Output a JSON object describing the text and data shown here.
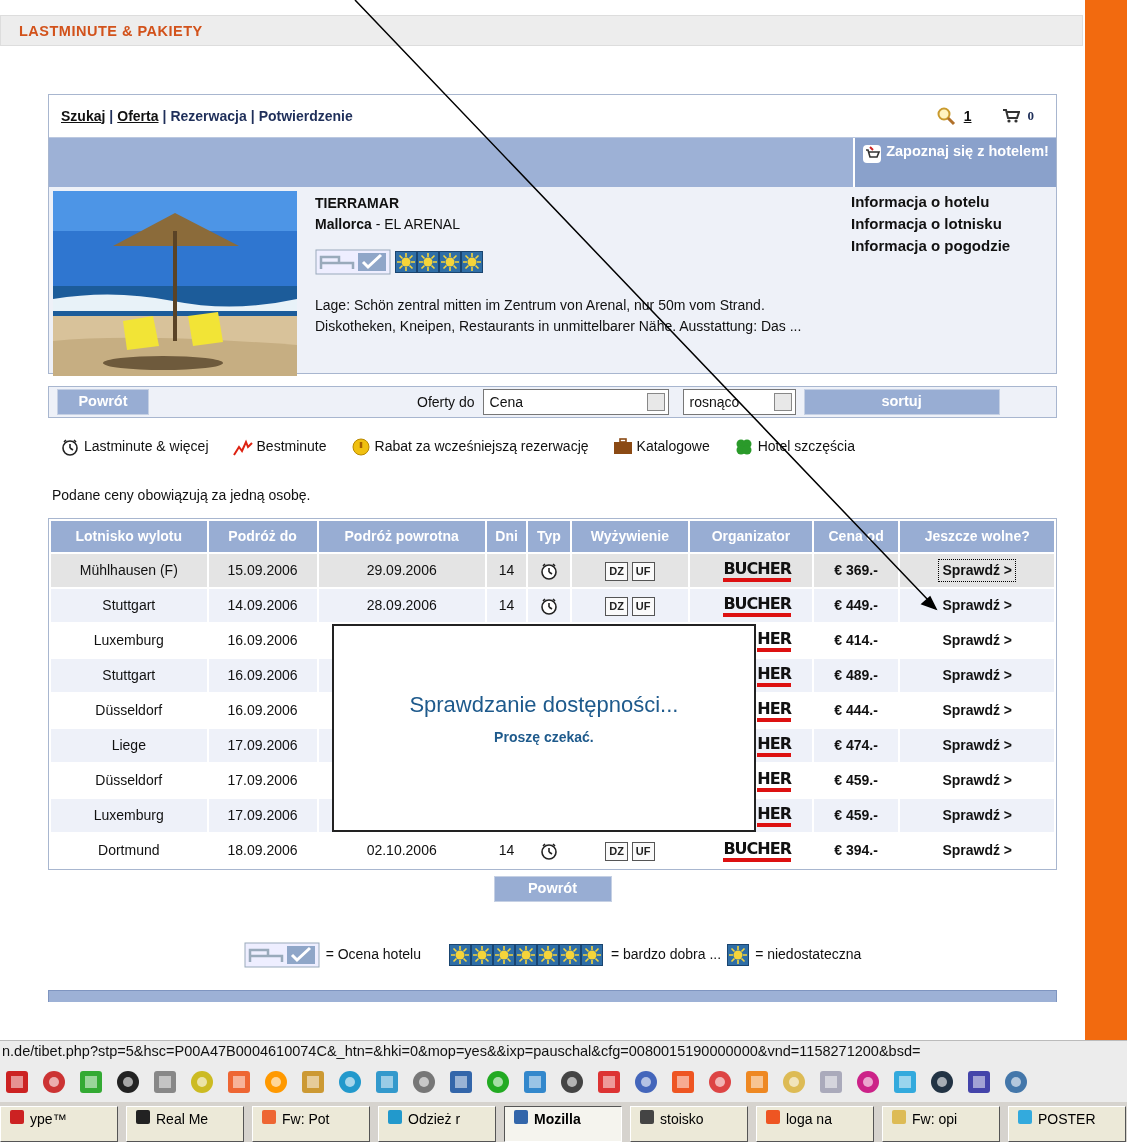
{
  "header": {
    "title": "LASTMINUTE & PAKIETY"
  },
  "nav": {
    "separator": "|",
    "steps": [
      {
        "label": "Szukaj",
        "link": true
      },
      {
        "label": "Oferta",
        "link": true
      },
      {
        "label": "Rezerwacja",
        "link": false
      },
      {
        "label": "Potwierdzenie",
        "link": false
      }
    ],
    "search_count": "1",
    "cart_count": "0"
  },
  "hotel": {
    "action": "Zapoznaj się z hotelem!",
    "name": "TIERRAMAR",
    "region": "Mallorca",
    "place": "- EL ARENAL",
    "stars": 4,
    "description": "Lage: Schön zentral mitten im Zentrum von Arenal, nur 50m vom Strand. Diskotheken, Kneipen, Restaurants in unmittelbarer Nähe. Ausstattung: Das ...",
    "links": [
      "Informacja o hotelu",
      "Informacja o lotnisku",
      "Informacja o pogodzie"
    ]
  },
  "sort_bar": {
    "back": "Powrót",
    "label": "Oferty do",
    "sort_field": "Cena",
    "order": "rosnąco",
    "sort_button": "sortuj"
  },
  "legend": [
    {
      "kind": "lastminute",
      "label": "Lastminute & więcej"
    },
    {
      "kind": "bestminute",
      "label": "Bestminute"
    },
    {
      "kind": "earlybird",
      "label": "Rabat za wcześniejszą rezerwację"
    },
    {
      "kind": "catalog",
      "label": "Katalogowe"
    },
    {
      "kind": "lucky",
      "label": "Hotel szczęścia"
    }
  ],
  "note": "Podane ceny obowiązują za jedną osobę.",
  "table": {
    "columns": [
      "Lotnisko wylotu",
      "Podróż do",
      "Podróż powrotna",
      "Dni",
      "Typ",
      "Wyżywienie",
      "Organizator",
      "Cena od",
      "Jeszcze wolne?"
    ],
    "rows": [
      {
        "airport": "Mühlhausen (F)",
        "depart": "15.09.2006",
        "return": "29.09.2006",
        "days": "14",
        "kind": "lastminute",
        "board": [
          "DZ",
          "UF"
        ],
        "organizer": "BUCHER",
        "price": "€ 369.-",
        "action": "Sprawdź >",
        "selected": true
      },
      {
        "airport": "Stuttgart",
        "depart": "14.09.2006",
        "return": "28.09.2006",
        "days": "14",
        "kind": "lastminute",
        "board": [
          "DZ",
          "UF"
        ],
        "organizer": "BUCHER",
        "price": "€ 449.-",
        "action": "Sprawdź >",
        "selected": false
      },
      {
        "airport": "Luxemburg",
        "depart": "16.09.2006",
        "organizer": "HER",
        "price": "€ 414.-",
        "action": "Sprawdź >",
        "selected": false
      },
      {
        "airport": "Stuttgart",
        "depart": "16.09.2006",
        "organizer": "HER",
        "price": "€ 489.-",
        "action": "Sprawdź >",
        "selected": false
      },
      {
        "airport": "Düsseldorf",
        "depart": "16.09.2006",
        "organizer": "HER",
        "price": "€ 444.-",
        "action": "Sprawdź >",
        "selected": false
      },
      {
        "airport": "Liege",
        "depart": "17.09.2006",
        "organizer": "HER",
        "price": "€ 474.-",
        "action": "Sprawdź >",
        "selected": false
      },
      {
        "airport": "Düsseldorf",
        "depart": "17.09.2006",
        "organizer": "HER",
        "price": "€ 459.-",
        "action": "Sprawdź >",
        "selected": false
      },
      {
        "airport": "Luxemburg",
        "depart": "17.09.2006",
        "organizer": "HER",
        "price": "€ 459.-",
        "action": "Sprawdź >",
        "selected": false
      },
      {
        "airport": "Dortmund",
        "depart": "18.09.2006",
        "return": "02.10.2006",
        "days": "14",
        "kind": "lastminute",
        "board": [
          "DZ",
          "UF"
        ],
        "organizer": "BUCHER",
        "price": "€ 394.-",
        "action": "Sprawdź >",
        "selected": false
      }
    ]
  },
  "dialog": {
    "title": "Sprawdzanie dostępności...",
    "message": "Proszę czekać."
  },
  "bottom_back": "Powrót",
  "rating_legend": {
    "label": "= Ocena hotelu",
    "scale": [
      {
        "stars": 7,
        "label": "= bardzo dobra ..."
      },
      {
        "kind": "sun",
        "label": "= niedostateczna"
      }
    ]
  },
  "status_bar": {
    "url": "n.de/tibet.php?stp=5&hsc=P00A47B0004610074C&_htn=&hki=0&mop=yes&&ixp=pauschal&cfg=0080015190000000&vnd=1158271200&bsd="
  },
  "taskbar": {
    "buttons": [
      {
        "label": "ype™",
        "selected": false
      },
      {
        "label": "Real Me",
        "selected": false
      },
      {
        "label": "Fw: Pot",
        "selected": false
      },
      {
        "label": "Odzież r",
        "selected": false
      },
      {
        "label": "Mozilla",
        "selected": true
      },
      {
        "label": "stoisko",
        "selected": false
      },
      {
        "label": "loga na",
        "selected": false
      },
      {
        "label": "Fw: opi",
        "selected": false
      },
      {
        "label": "POSTER",
        "selected": false
      }
    ]
  }
}
